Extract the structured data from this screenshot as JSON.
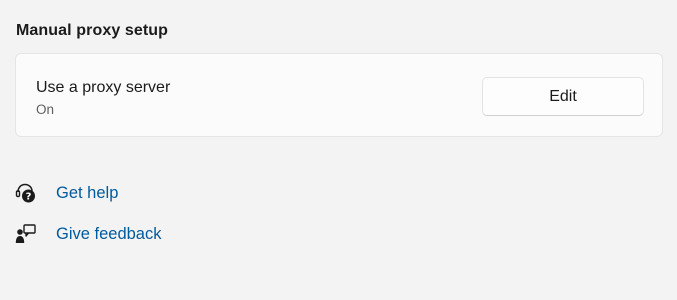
{
  "section": {
    "title": "Manual proxy setup"
  },
  "proxy_card": {
    "title": "Use a proxy server",
    "status": "On",
    "button_label": "Edit"
  },
  "links": {
    "help": {
      "label": "Get help",
      "icon": "help-icon"
    },
    "feedback": {
      "label": "Give feedback",
      "icon": "feedback-icon"
    }
  },
  "colors": {
    "background": "#f3f3f3",
    "card": "#fbfbfb",
    "link": "#005a9e"
  }
}
